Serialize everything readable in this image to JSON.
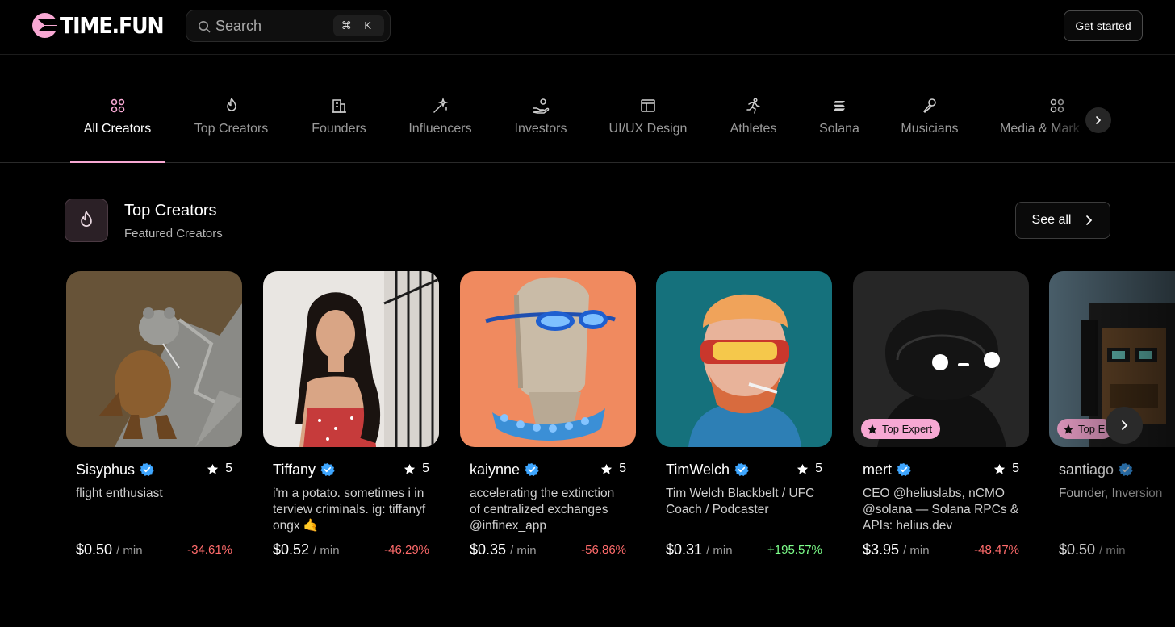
{
  "header": {
    "logo_text": "TIME.FUN",
    "search_placeholder": "Search",
    "search_shortcut": "⌘ K",
    "cta_label": "Get started"
  },
  "categories": [
    {
      "label": "All Creators",
      "icon": "apps-icon",
      "active": true
    },
    {
      "label": "Top Creators",
      "icon": "flame-icon"
    },
    {
      "label": "Founders",
      "icon": "building-icon"
    },
    {
      "label": "Influencers",
      "icon": "sparkle-wand-icon"
    },
    {
      "label": "Investors",
      "icon": "hand-coins-icon"
    },
    {
      "label": "UI/UX Design",
      "icon": "layout-icon"
    },
    {
      "label": "Athletes",
      "icon": "runner-icon"
    },
    {
      "label": "Solana",
      "icon": "solana-icon"
    },
    {
      "label": "Musicians",
      "icon": "microphone-icon"
    },
    {
      "label": "Media & Mark",
      "icon": "apps-icon"
    }
  ],
  "section": {
    "title": "Top Creators",
    "subtitle": "Featured Creators",
    "see_all_label": "See all"
  },
  "creators": [
    {
      "name": "Sisyphus",
      "rating": "5",
      "bio": "flight enthusiast",
      "price": "$0.50",
      "unit": "/ min",
      "change": "-34.61%",
      "trend": "down",
      "badge": ""
    },
    {
      "name": "Tiffany",
      "rating": "5",
      "bio": "i'm a potato. sometimes i in terview criminals. ig: tiffanyf ongx 🤙",
      "price": "$0.52",
      "unit": "/ min",
      "change": "-46.29%",
      "trend": "down",
      "badge": ""
    },
    {
      "name": "kaiynne",
      "rating": "5",
      "bio": "accelerating the extinction of centralized exchanges @infinex_app",
      "price": "$0.35",
      "unit": "/ min",
      "change": "-56.86%",
      "trend": "down",
      "badge": ""
    },
    {
      "name": "TimWelch",
      "rating": "5",
      "bio": "Tim Welch Blackbelt / UFC Coach / Podcaster",
      "price": "$0.31",
      "unit": "/ min",
      "change": "+195.57%",
      "trend": "up",
      "badge": ""
    },
    {
      "name": "mert",
      "rating": "5",
      "bio": "CEO @heliuslabs, nCMO @solana — Solana RPCs & APIs: helius.dev",
      "price": "$3.95",
      "unit": "/ min",
      "change": "-48.47%",
      "trend": "down",
      "badge": "Top Expert"
    },
    {
      "name": "santiago",
      "rating": "",
      "bio": "Founder, Inversion",
      "price": "$0.50",
      "unit": "/ min",
      "change": "",
      "trend": "",
      "badge": "Top E"
    }
  ],
  "colors": {
    "accent": "#f7a8d3",
    "negative": "#ff6b6b",
    "positive": "#7dff8a",
    "verified": "#3ea6ff"
  }
}
